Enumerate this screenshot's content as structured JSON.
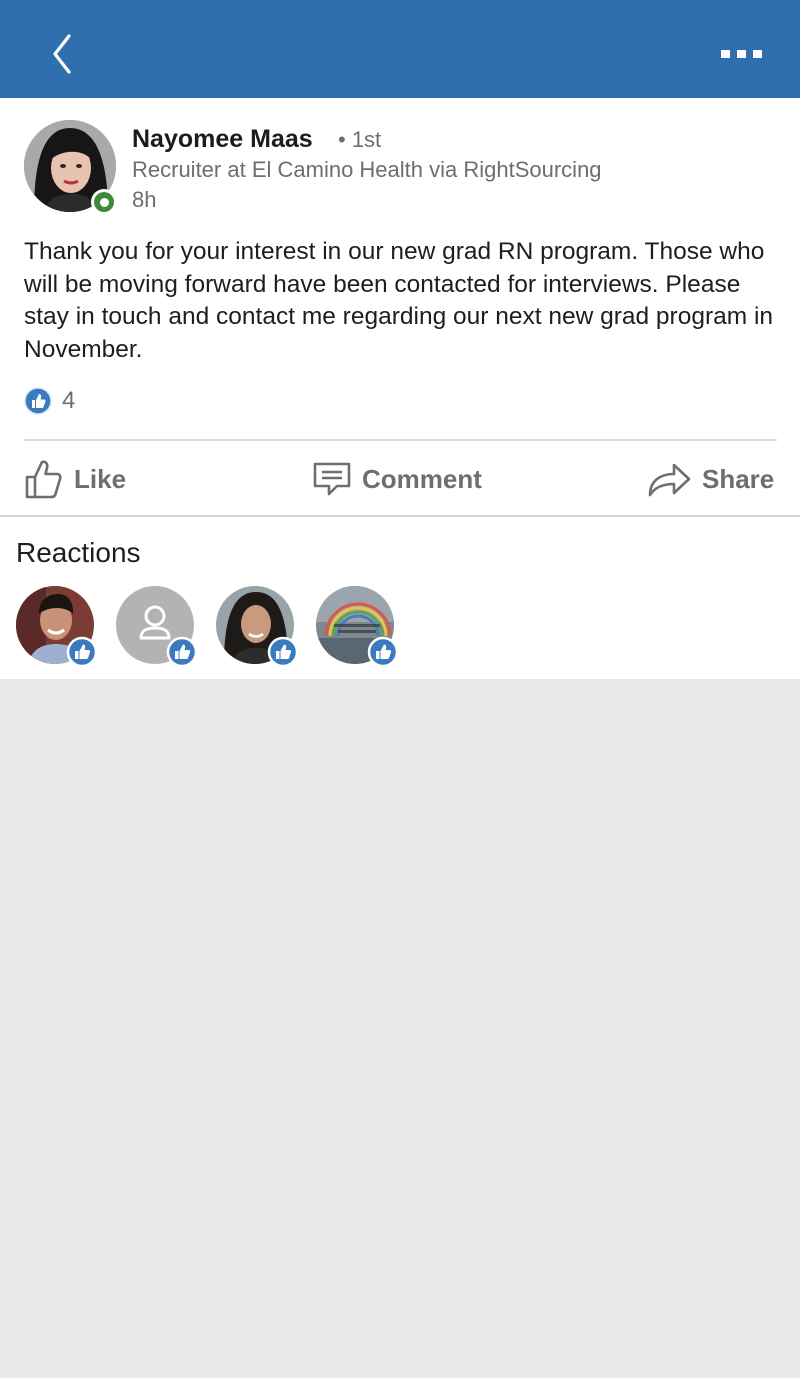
{
  "nav": {
    "back_icon": "chevron-left-icon",
    "more_icon": "more-horizontal-icon",
    "bar_color": "#2f6fae"
  },
  "post": {
    "author": {
      "name": "Nayomee Maas",
      "degree": "• 1st",
      "headline": "Recruiter at El Camino Health via RightSourcing",
      "time": "8h",
      "online_status_color": "#3f8a3a"
    },
    "body": "Thank you for your interest in our new grad RN program. Those who will be moving forward have been contacted for interviews. Please stay in touch and contact me regarding our next new grad program in November.",
    "like_count": "4",
    "actions": {
      "like": "Like",
      "comment": "Comment",
      "share": "Share"
    }
  },
  "reactions": {
    "title": "Reactions",
    "items": [
      {
        "type": "photo-man",
        "reaction": "like"
      },
      {
        "type": "placeholder",
        "reaction": "like"
      },
      {
        "type": "photo-woman",
        "reaction": "like"
      },
      {
        "type": "photo-rainbow",
        "reaction": "like"
      }
    ]
  },
  "colors": {
    "like_blue": "#3a7bbf",
    "muted_text": "#6e6e6e",
    "background": "#e8e8e8"
  }
}
